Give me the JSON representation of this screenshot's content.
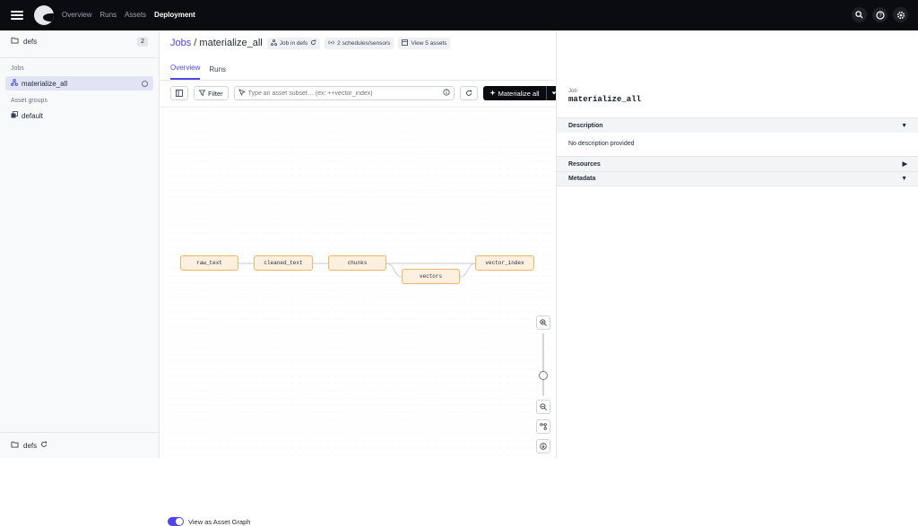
{
  "topbar": {
    "nav": [
      {
        "label": "Overview",
        "active": false
      },
      {
        "label": "Runs",
        "active": false
      },
      {
        "label": "Assets",
        "active": false
      },
      {
        "label": "Deployment",
        "active": true
      }
    ],
    "icons": [
      "search-icon",
      "help-icon",
      "settings-icon"
    ]
  },
  "sidebar": {
    "header": {
      "label": "defs",
      "badge": "2"
    },
    "jobs_section": "Jobs",
    "jobs": [
      {
        "label": "materialize_all",
        "active": true
      }
    ],
    "asset_groups_section": "Asset groups",
    "asset_groups": [
      {
        "label": "default"
      }
    ],
    "footer": {
      "label": "defs"
    }
  },
  "header": {
    "breadcrumb_parent": "Jobs",
    "separator": " / ",
    "title": "materialize_all",
    "tags": [
      {
        "label": "Job in defs",
        "icon": "job-icon"
      },
      {
        "label": "2 schedules/sensors",
        "icon": "sensor-icon"
      },
      {
        "label": "View 5 assets",
        "icon": "assets-icon"
      }
    ]
  },
  "tabs": [
    {
      "label": "Overview",
      "active": true
    },
    {
      "label": "Runs",
      "active": false
    }
  ],
  "toolbar": {
    "filter_label": "Filter",
    "search_placeholder": "Type an asset subset… (ex: ++vector_index)",
    "materialize_label": "Materialize all"
  },
  "graph": {
    "nodes": [
      "raw_text",
      "cleaned_text",
      "chunks",
      "vectors",
      "vector_index"
    ],
    "edges": [
      [
        "raw_text",
        "cleaned_text"
      ],
      [
        "cleaned_text",
        "chunks"
      ],
      [
        "chunks",
        "vectors"
      ],
      [
        "vectors",
        "vector_index"
      ],
      [
        "chunks",
        "vector_index"
      ]
    ],
    "zoom_level": 0.3,
    "toggle_label": "View as Asset Graph",
    "toggle_on": true
  },
  "panel": {
    "label": "Job",
    "title": "materialize_all",
    "sections": [
      {
        "title": "Description",
        "expanded": true,
        "body": "No description provided"
      },
      {
        "title": "Resources",
        "expanded": false
      },
      {
        "title": "Metadata",
        "expanded": true
      }
    ]
  },
  "colors": {
    "accent": "#4f46e5",
    "node_border": "#f0b46a",
    "node_fill": "#fdf0df",
    "topbar": "#0b0c10"
  }
}
